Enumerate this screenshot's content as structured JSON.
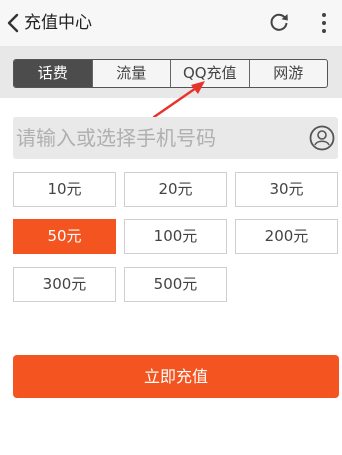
{
  "header": {
    "title": "充值中心"
  },
  "tabs": [
    {
      "label": "话费",
      "active": true
    },
    {
      "label": "流量",
      "active": false
    },
    {
      "label": "QQ充值",
      "active": false
    },
    {
      "label": "网游",
      "active": false
    }
  ],
  "phone_input": {
    "placeholder": "请输入或选择手机号码"
  },
  "amounts": [
    {
      "label": "10元",
      "selected": false
    },
    {
      "label": "20元",
      "selected": false
    },
    {
      "label": "30元",
      "selected": false
    },
    {
      "label": "50元",
      "selected": true
    },
    {
      "label": "100元",
      "selected": false
    },
    {
      "label": "200元",
      "selected": false
    },
    {
      "label": "300元",
      "selected": false
    },
    {
      "label": "500元",
      "selected": false
    }
  ],
  "charge_button": {
    "label": "立即充值"
  },
  "colors": {
    "accent": "#f4541f",
    "active_tab": "#4c4c4c",
    "annotation_arrow": "#e8322a"
  },
  "icons": [
    "back-chevron-icon",
    "refresh-icon",
    "more-vertical-icon",
    "contact-icon"
  ]
}
